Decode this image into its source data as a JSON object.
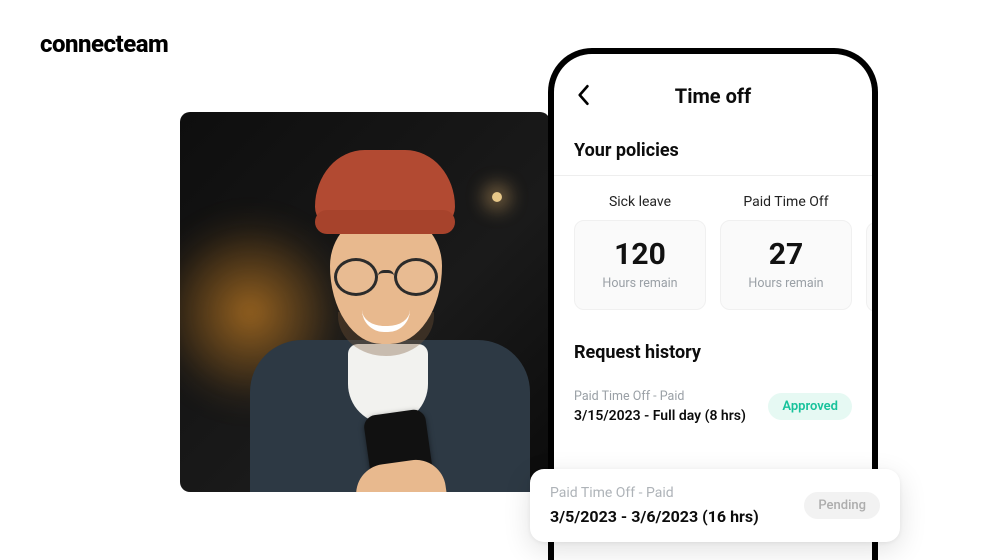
{
  "brand": "connecteam",
  "header": {
    "title": "Time off"
  },
  "sections": {
    "policies_title": "Your policies",
    "history_title": "Request history"
  },
  "policies": [
    {
      "name": "Sick leave",
      "value": "120",
      "caption": "Hours remain"
    },
    {
      "name": "Paid Time Off",
      "value": "27",
      "caption": "Hours remain"
    }
  ],
  "history": [
    {
      "type": "Paid Time Off - Paid",
      "desc": "3/15/2023 - Full day (8 hrs)",
      "status": "Approved",
      "status_kind": "approved"
    }
  ],
  "popout": {
    "type": "Paid Time Off - Paid",
    "desc": "3/5/2023 - 3/6/2023 (16 hrs)",
    "status": "Pending",
    "status_kind": "pending"
  },
  "colors": {
    "approved": "#17c29b",
    "approved_bg": "#e6f9f3",
    "pending": "#adadad",
    "pending_bg": "#f2f2f2"
  }
}
